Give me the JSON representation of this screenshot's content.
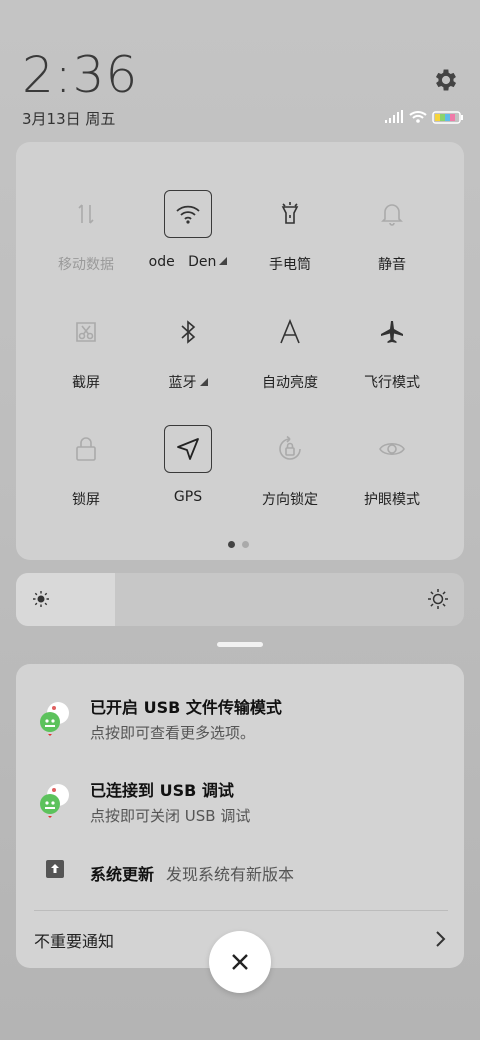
{
  "header": {
    "time": "2:36",
    "date": "3月13日 周五"
  },
  "tiles": [
    {
      "label": "移动数据",
      "icon": "mobile-data-icon",
      "active": false
    },
    {
      "label": "ode   Den",
      "icon": "wifi-icon",
      "active": true
    },
    {
      "label": "手电筒",
      "icon": "flashlight-icon",
      "active": false
    },
    {
      "label": "静音",
      "icon": "bell-icon",
      "active": false
    },
    {
      "label": "截屏",
      "icon": "screenshot-icon",
      "active": false
    },
    {
      "label": "蓝牙",
      "icon": "bluetooth-icon",
      "active": false
    },
    {
      "label": "自动亮度",
      "icon": "auto-brightness-icon",
      "active": false
    },
    {
      "label": "飞行模式",
      "icon": "airplane-icon",
      "active": false
    },
    {
      "label": "锁屏",
      "icon": "lock-icon",
      "active": false
    },
    {
      "label": "GPS",
      "icon": "gps-icon",
      "active": true
    },
    {
      "label": "方向锁定",
      "icon": "rotation-lock-icon",
      "active": false
    },
    {
      "label": "护眼模式",
      "icon": "eye-icon",
      "active": false
    }
  ],
  "pager": {
    "pages": 2,
    "current": 1
  },
  "brightness": {
    "level_percent": 22
  },
  "notifications": [
    {
      "title": "已开启 USB 文件传输模式",
      "subtitle": "点按即可查看更多选项。",
      "icon": "android-debug-icon"
    },
    {
      "title": "已连接到 USB 调试",
      "subtitle": "点按即可关闭 USB 调试",
      "icon": "android-debug-icon"
    },
    {
      "title": "系统更新",
      "subtitle": "发现系统有新版本",
      "icon": "system-update-icon"
    }
  ],
  "unimportant_label": "不重要通知",
  "colors": {
    "panel": "#d0d0d0",
    "icon_dim": "#9a9a9a",
    "icon_dark": "#333333"
  }
}
